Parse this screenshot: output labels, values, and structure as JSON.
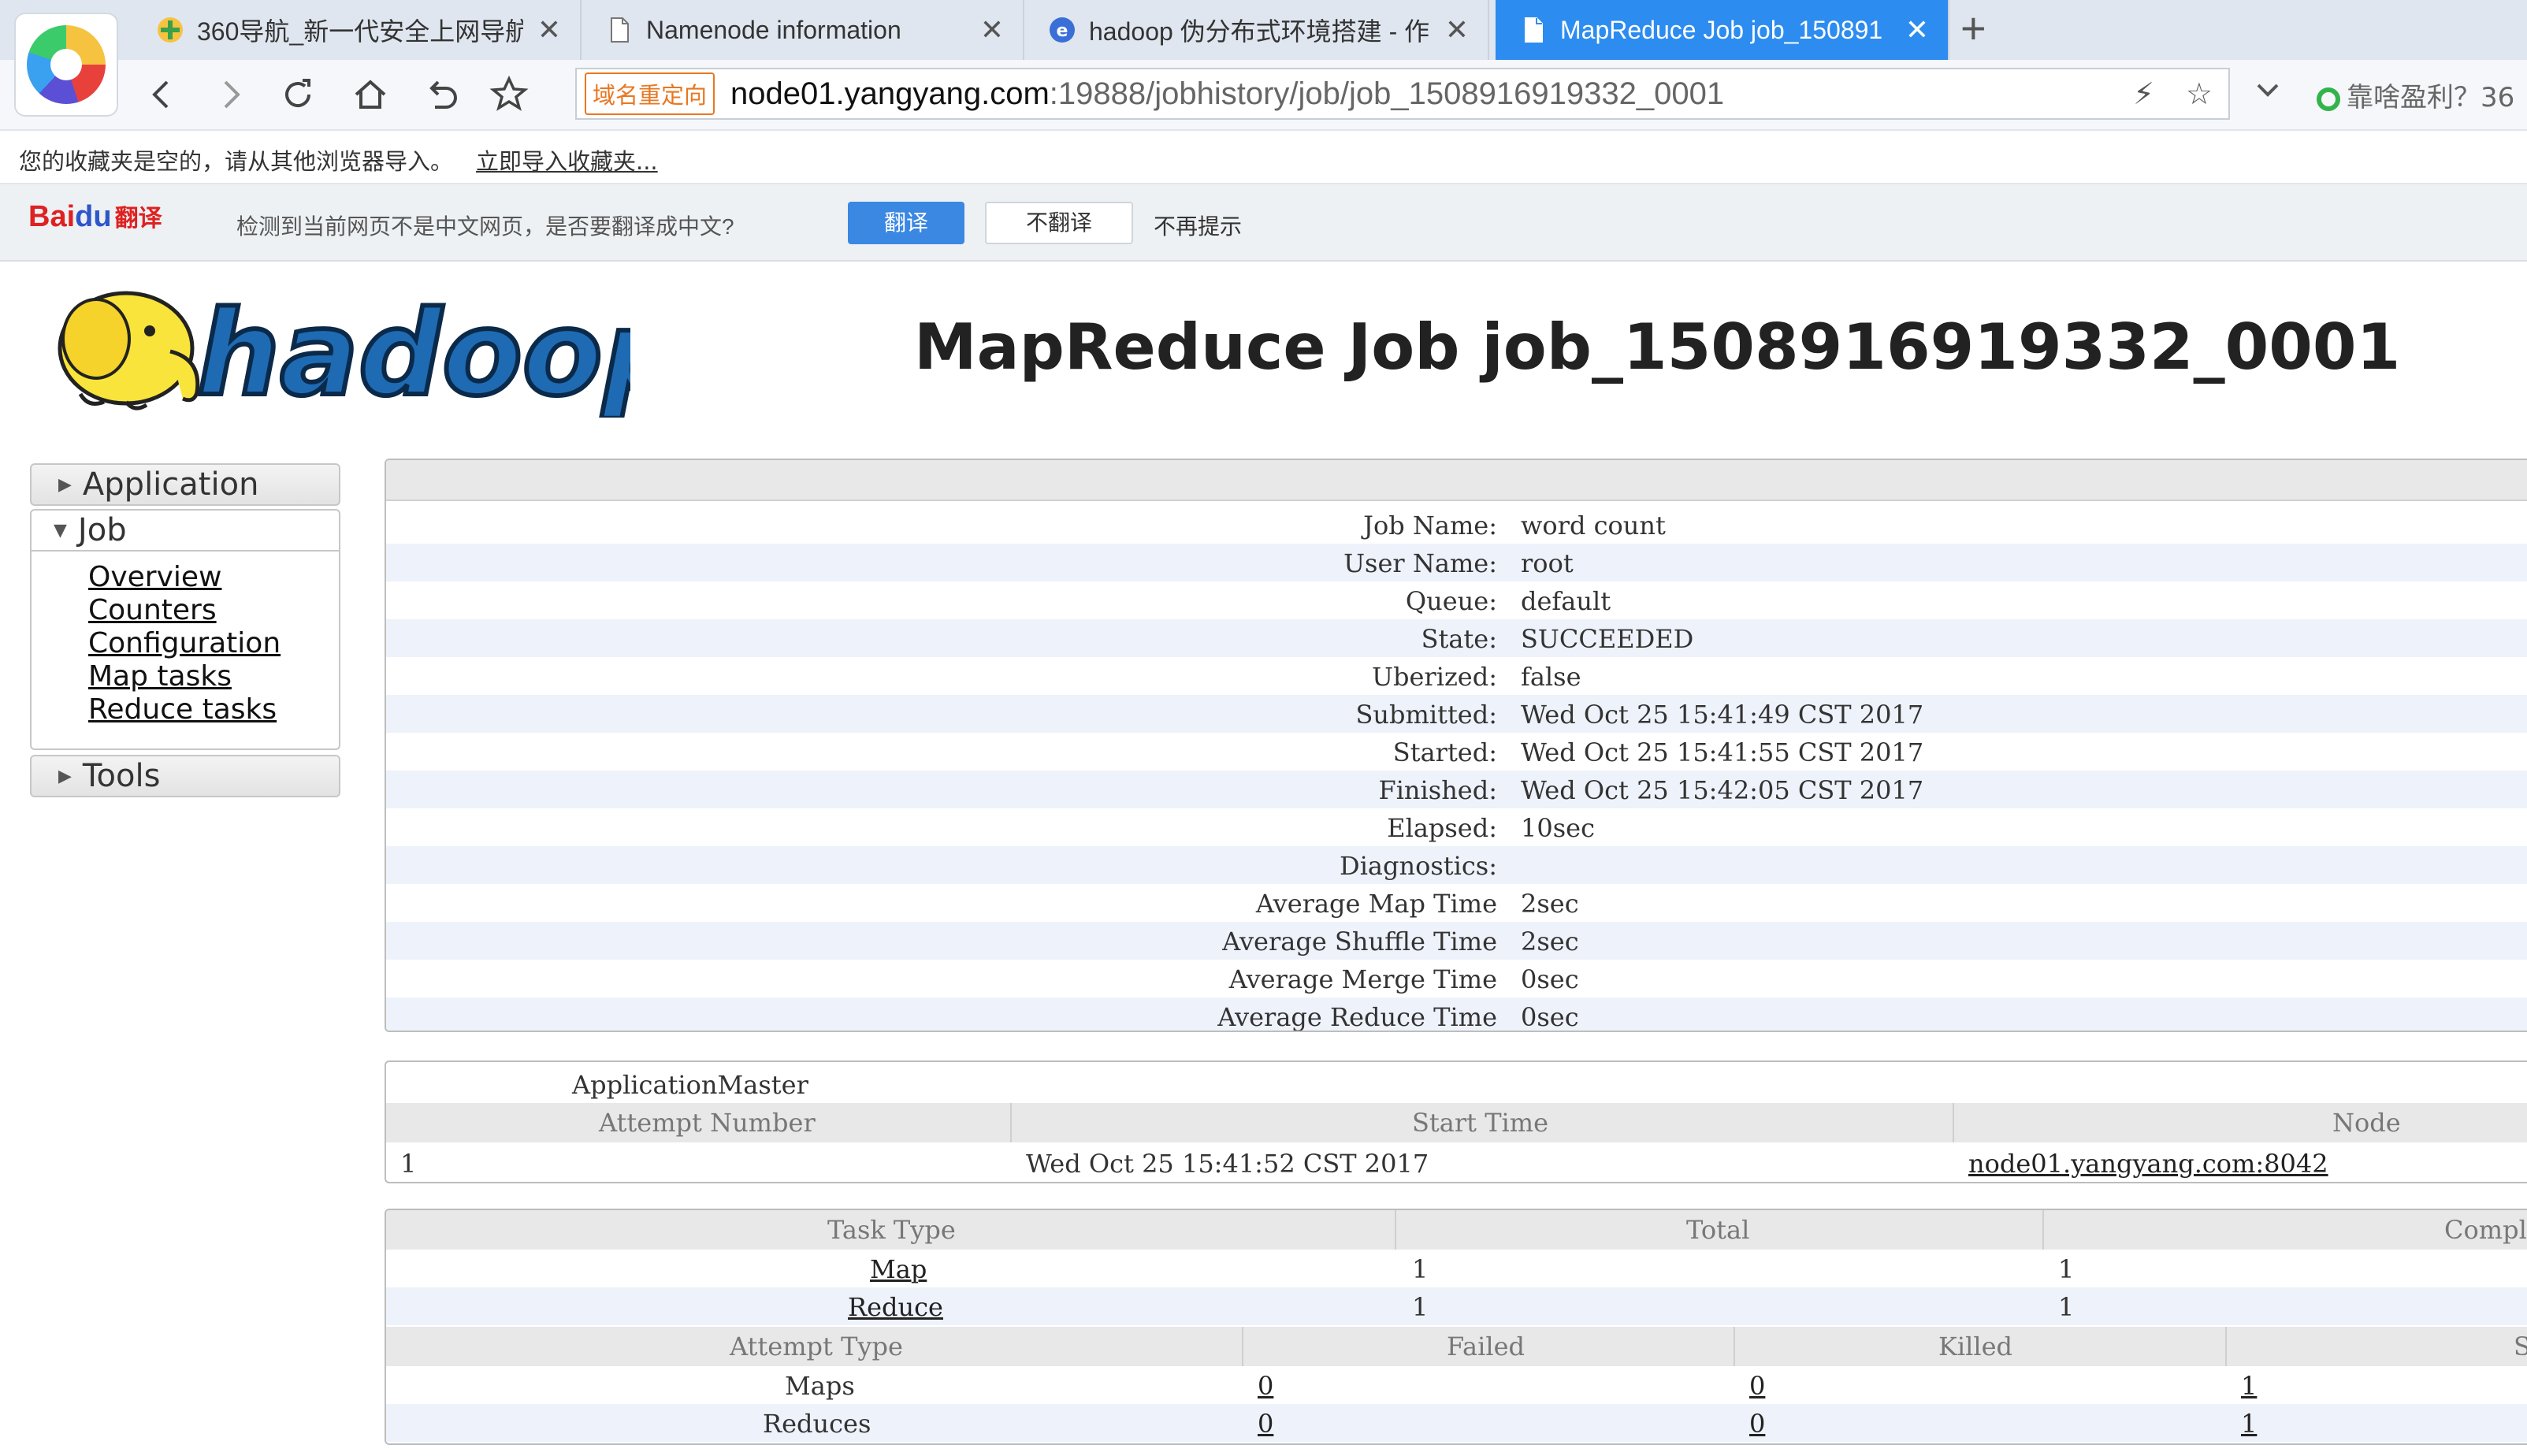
{
  "browser": {
    "tabs": [
      {
        "title": "360导航_新一代安全上网导航",
        "icon": "360-nav-icon",
        "active": false
      },
      {
        "title": "Namenode information",
        "icon": "page-icon",
        "active": false
      },
      {
        "title": "hadoop 伪分布式环境搭建 - 作",
        "icon": "browser-e-icon",
        "active": false
      },
      {
        "title": "MapReduce Job job_150891",
        "icon": "page-icon",
        "active": true
      }
    ],
    "new_tab_label": "+",
    "address": {
      "badge": "域名重定向",
      "host": "node01.yangyang.com",
      "rest": ":19888/jobhistory/job/job_1508916919332_0001"
    },
    "search_box_text": "靠啥盈利？36"
  },
  "bookmarks_bar": {
    "message": "您的收藏夹是空的，请从其他浏览器导入。",
    "import_link": "立即导入收藏夹..."
  },
  "translate_bar": {
    "logo_bai": "Bai",
    "logo_du": "du",
    "logo_fanyi": "翻译",
    "message": "检测到当前网页不是中文网页，是否要翻译成中文?",
    "translate_btn": "翻译",
    "no_translate_btn": "不翻译",
    "never_btn": "不再提示"
  },
  "page": {
    "logo_text": "hadoop",
    "title": "MapReduce Job job_1508916919332_0001"
  },
  "sidebar": {
    "application": "Application",
    "job": "Job",
    "job_links": [
      "Overview",
      "Counters",
      "Configuration",
      "Map tasks",
      "Reduce tasks"
    ],
    "tools": "Tools"
  },
  "job_info": [
    {
      "label": "Job Name:",
      "value": "word count"
    },
    {
      "label": "User Name:",
      "value": "root"
    },
    {
      "label": "Queue:",
      "value": "default"
    },
    {
      "label": "State:",
      "value": "SUCCEEDED"
    },
    {
      "label": "Uberized:",
      "value": "false"
    },
    {
      "label": "Submitted:",
      "value": "Wed Oct 25 15:41:49 CST 2017"
    },
    {
      "label": "Started:",
      "value": "Wed Oct 25 15:41:55 CST 2017"
    },
    {
      "label": "Finished:",
      "value": "Wed Oct 25 15:42:05 CST 2017"
    },
    {
      "label": "Elapsed:",
      "value": "10sec"
    },
    {
      "label": "Diagnostics:",
      "value": ""
    },
    {
      "label": "Average Map Time",
      "value": "2sec"
    },
    {
      "label": "Average Shuffle Time",
      "value": "2sec"
    },
    {
      "label": "Average Merge Time",
      "value": "0sec"
    },
    {
      "label": "Average Reduce Time",
      "value": "0sec"
    }
  ],
  "application_master": {
    "title": "ApplicationMaster",
    "headers": [
      "Attempt Number",
      "Start Time",
      "Node"
    ],
    "row": {
      "attempt": "1",
      "start_time": "Wed Oct 25 15:41:52 CST 2017",
      "node": "node01.yangyang.com:8042"
    }
  },
  "tasks": {
    "headers": [
      "Task Type",
      "Total",
      "Comple"
    ],
    "rows": [
      {
        "type": "Map",
        "total": "1",
        "complete": "1"
      },
      {
        "type": "Reduce",
        "total": "1",
        "complete": "1"
      }
    ],
    "attempt_headers": [
      "Attempt Type",
      "Failed",
      "Killed",
      "S"
    ],
    "attempt_rows": [
      {
        "type": "Maps",
        "failed": "0",
        "killed": "0",
        "successful": "1"
      },
      {
        "type": "Reduces",
        "failed": "0",
        "killed": "0",
        "successful": "1"
      }
    ]
  }
}
